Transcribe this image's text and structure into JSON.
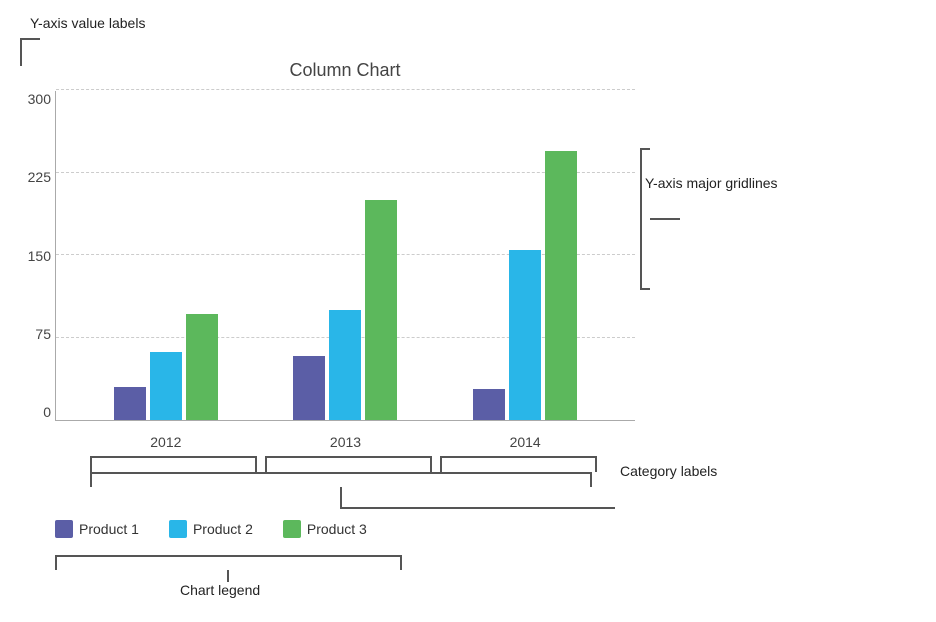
{
  "chart": {
    "title": "Column Chart",
    "y_axis": {
      "labels": [
        "0",
        "75",
        "150",
        "225",
        "300"
      ],
      "annotation": "Y-axis value labels"
    },
    "x_axis": {
      "labels": [
        "2012",
        "2013",
        "2014"
      ],
      "annotation": "Category labels"
    },
    "gridlines_annotation": "Y-axis major gridlines",
    "legend_annotation": "Chart legend",
    "bar_groups": [
      {
        "category": "2012",
        "product1": 30,
        "product2": 62,
        "product3": 96
      },
      {
        "category": "2013",
        "product1": 58,
        "product2": 100,
        "product3": 200
      },
      {
        "category": "2014",
        "product1": 28,
        "product2": 155,
        "product3": 245
      }
    ],
    "legend": {
      "items": [
        {
          "label": "Product 1",
          "color": "#5b5ea6"
        },
        {
          "label": "Product 2",
          "color": "#29b6e8"
        },
        {
          "label": "Product 3",
          "color": "#5cb85c"
        }
      ]
    }
  },
  "colors": {
    "product1": "#5b5ea6",
    "product2": "#29b6e8",
    "product3": "#5cb85c"
  }
}
